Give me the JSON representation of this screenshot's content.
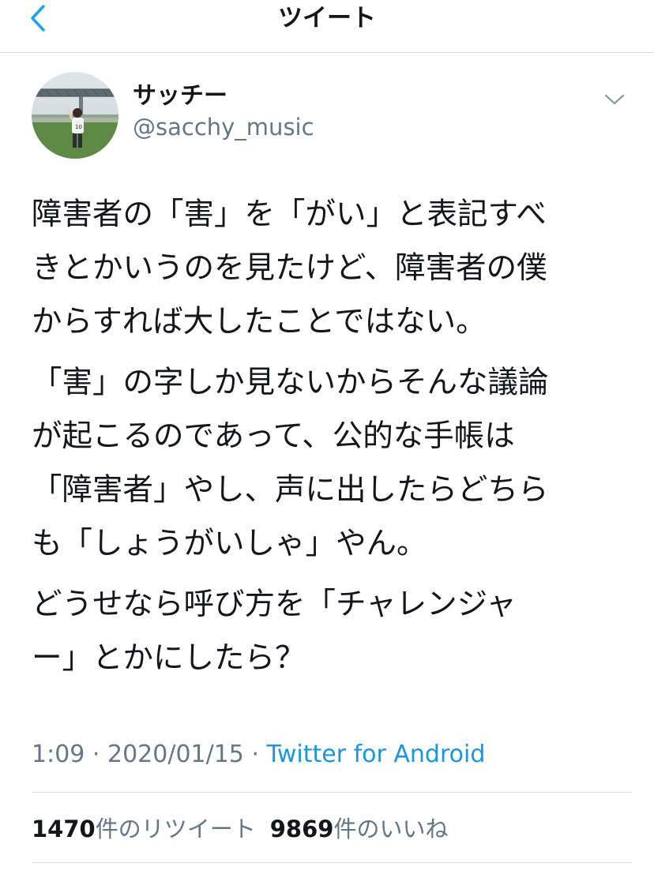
{
  "nav": {
    "title": "ツイート",
    "accent_color": "#1da1f2"
  },
  "user": {
    "display_name": "サッチー",
    "handle": "@sacchy_music"
  },
  "tweet": {
    "paragraphs": [
      [
        "障害者の「害」を「がい」と表記すべ",
        "きとかいうのを見たけど、障害者の僕",
        "からすれば大したことではない。"
      ],
      [
        "「害」の字しか見ないからそんな議論",
        "が起こるのであって、公的な手帳は",
        "「障害者」やし、声に出したらどちら",
        "も「しょうがいしゃ」やん。"
      ],
      [
        "どうせなら呼び方を「チャレンジャ",
        "ー」とかにしたら？"
      ]
    ],
    "time": "1:09",
    "separator": " · ",
    "date": "2020/01/15",
    "source": "Twitter for Android",
    "source_color": "#1b95e0"
  },
  "stats": {
    "retweets_count": "1470",
    "retweets_label": "件のリツイート",
    "likes_count": "9869",
    "likes_label": "件のいいね"
  }
}
